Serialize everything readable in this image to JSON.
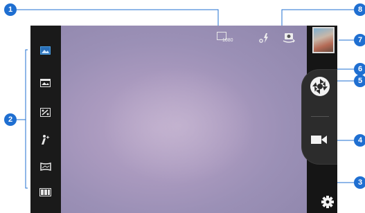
{
  "callouts": {
    "c1": "1",
    "c2": "2",
    "c3": "3",
    "c4": "4",
    "c5": "5",
    "c6": "6",
    "c7": "7",
    "c8": "8"
  },
  "top_bar": {
    "resolution_text": "1080",
    "icons": [
      "resolution-icon",
      "flash-icon",
      "switch-camera-icon"
    ]
  },
  "mode_bar": {
    "items": [
      "normal-mode-icon",
      "panorama-mode-icon",
      "hdr-mode-icon",
      "beauty-mode-icon",
      "wide-mode-icon",
      "multi-frame-mode-icon"
    ]
  },
  "right_bar": {
    "icons": [
      "gallery-thumbnail",
      "shutter-icon",
      "video-record-icon",
      "settings-gear-icon"
    ]
  },
  "colors": {
    "callout": "#1f6fd1",
    "accent": "#4aa0e6"
  }
}
